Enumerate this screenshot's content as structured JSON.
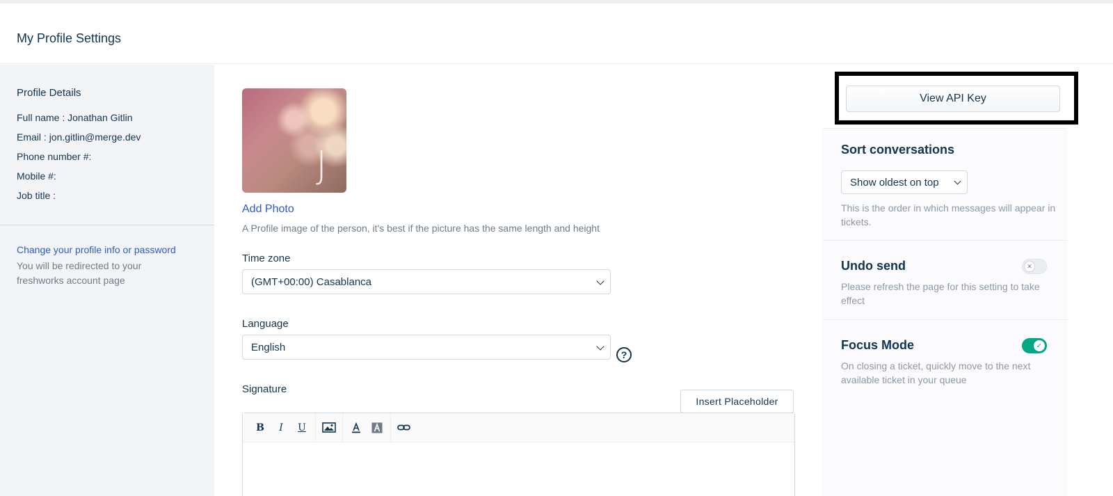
{
  "header": {
    "title": "My Profile Settings"
  },
  "sidebar": {
    "heading": "Profile Details",
    "rows": [
      {
        "label": "Full name : ",
        "value": "Jonathan Gitlin"
      },
      {
        "label": "Email : ",
        "value": "jon.gitlin@merge.dev"
      },
      {
        "label": "Phone number #:",
        "value": ""
      },
      {
        "label": "Mobile #:",
        "value": ""
      },
      {
        "label": "Job title :",
        "value": ""
      }
    ],
    "link": "Change your profile info or password",
    "note": "You will be redirected to your freshworks account page"
  },
  "main": {
    "avatar_initial": "J",
    "add_photo": "Add Photo",
    "photo_hint": "A Profile image of the person, it's best if the picture has the same length and height",
    "timezone": {
      "label": "Time zone",
      "value": "(GMT+00:00) Casablanca"
    },
    "language": {
      "label": "Language",
      "value": "English",
      "help": "?"
    },
    "signature": {
      "label": "Signature",
      "insert_placeholder": "Insert Placeholder",
      "toolbar": {
        "bold": "B",
        "italic": "I",
        "underline": "U"
      }
    }
  },
  "right": {
    "api_button": "View API Key",
    "sort": {
      "title": "Sort conversations",
      "value": "Show oldest on top",
      "desc": "This is the order in which messages will appear in tickets."
    },
    "undo": {
      "title": "Undo send",
      "desc": "Please refresh the page for this setting to take effect",
      "enabled": false
    },
    "focus": {
      "title": "Focus Mode",
      "desc": "On closing a ticket, quickly move to the next available ticket in your queue",
      "enabled": true
    }
  },
  "colors": {
    "link": "#2c5cc5",
    "toggle_on": "#00a886",
    "text": "#12344d",
    "muted": "#6f7c87"
  }
}
